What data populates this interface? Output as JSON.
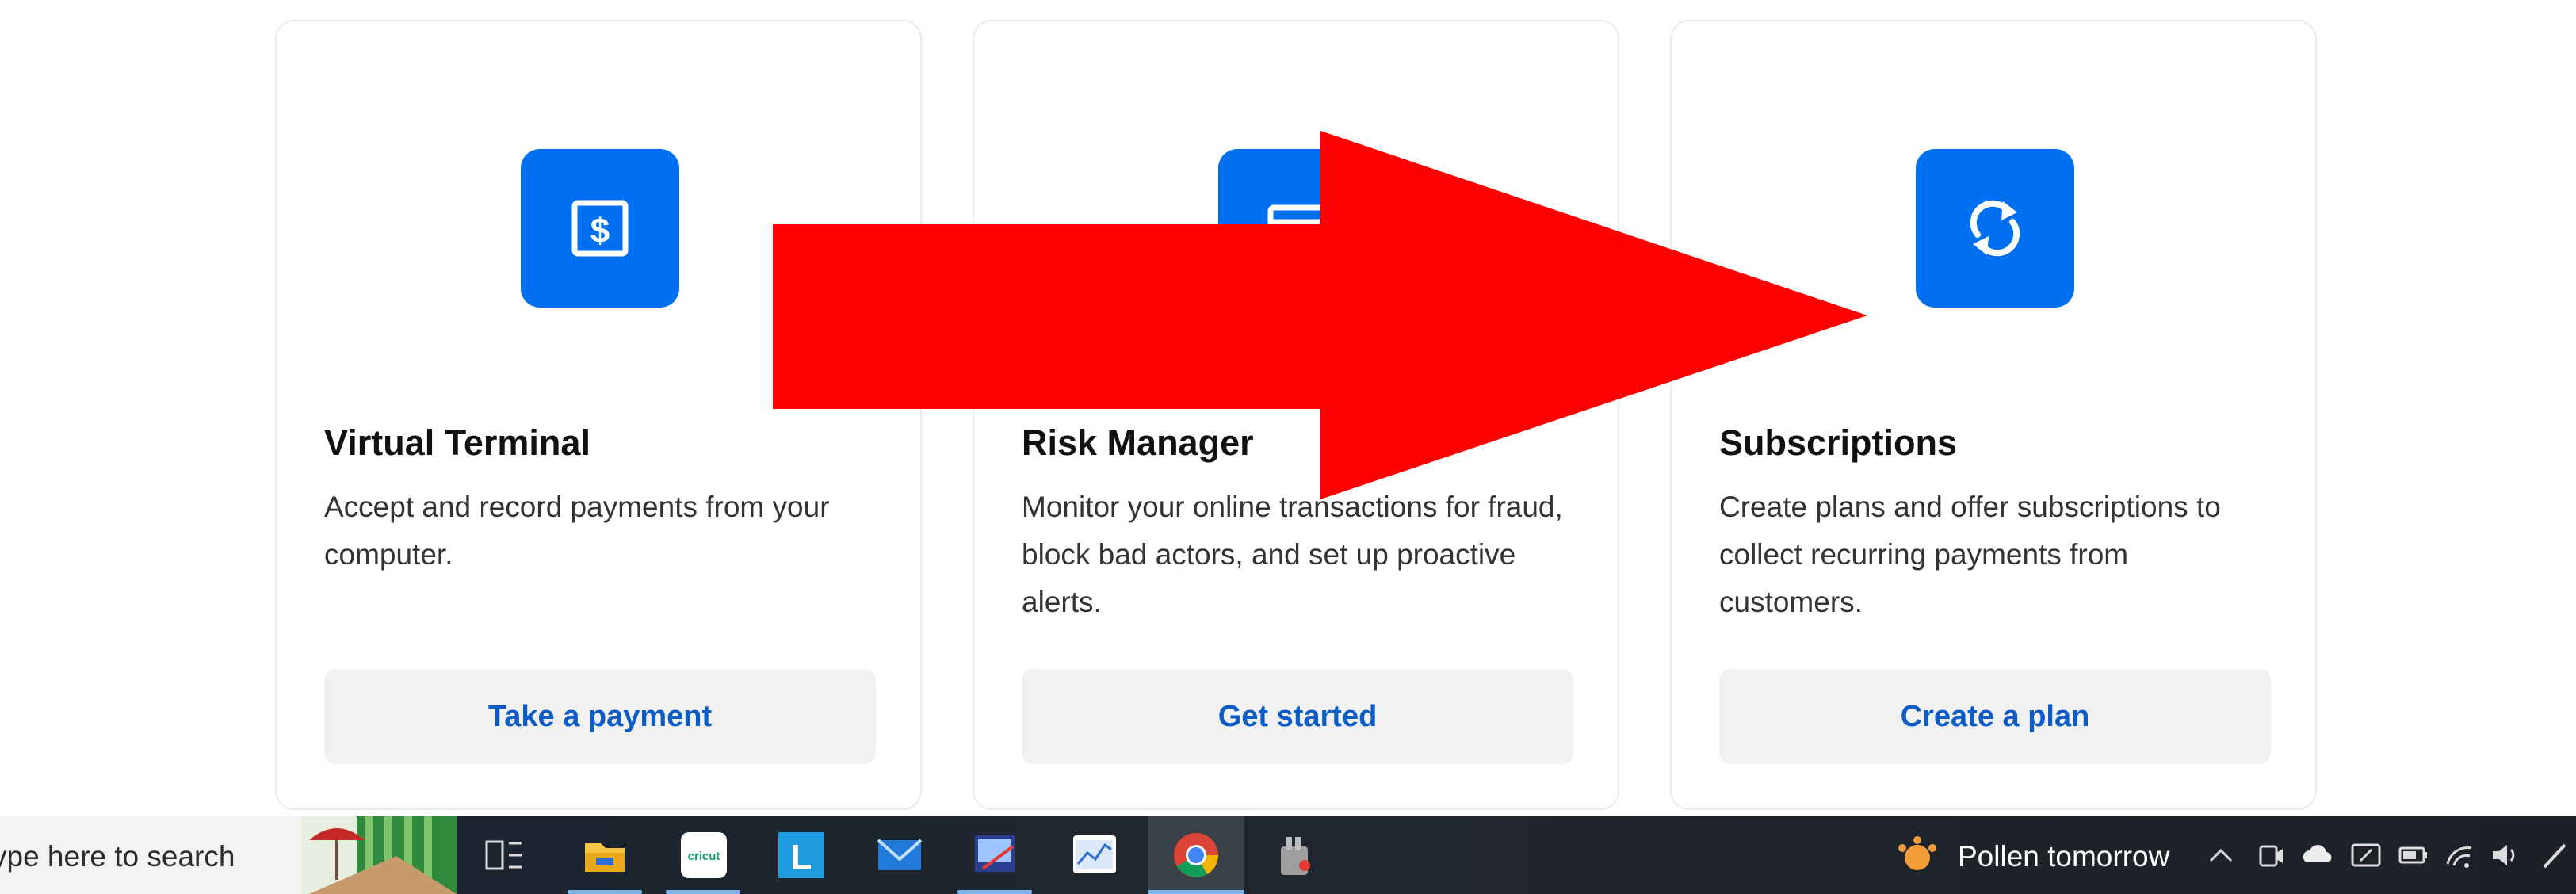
{
  "cards": [
    {
      "title": "Virtual Terminal",
      "description": "Accept and record payments from your computer.",
      "button": "Take a payment",
      "icon": "dollar-screen-icon"
    },
    {
      "title": "Risk Manager",
      "description": "Monitor your online transactions for fraud, block bad actors, and set up proactive alerts.",
      "button": "Get started",
      "icon": "card-icon"
    },
    {
      "title": "Subscriptions",
      "description": "Create plans and offer subscriptions to collect recurring payments from customers.",
      "button": "Create a plan",
      "icon": "refresh-icon"
    }
  ],
  "annotation": {
    "shape": "arrow",
    "color": "#ff0000",
    "direction": "right"
  },
  "taskbar": {
    "search_placeholder": "ype here to search",
    "apps": [
      "task-view-icon",
      "file-explorer-icon",
      "cricut-icon",
      "l-app-icon",
      "mail-icon",
      "image-editor-icon",
      "chart-app-icon",
      "chrome-icon",
      "tool-app-icon"
    ],
    "cricut_label": "cricut",
    "l_label": "L",
    "weather": "Pollen tomorrow"
  },
  "colors": {
    "accent": "#0070f0",
    "link": "#0b5cc7",
    "button_bg": "#f1f1f1",
    "arrow": "#ff0000"
  }
}
